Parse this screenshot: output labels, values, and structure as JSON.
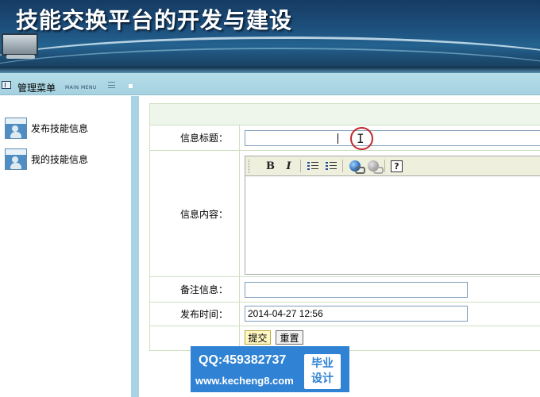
{
  "banner": {
    "title": "技能交换平台的开发与建设"
  },
  "menubar": {
    "title": "管理菜单",
    "subtitle": "MAIN MENU"
  },
  "sidebar": {
    "items": [
      {
        "label": "发布技能信息",
        "icon": "user-icon"
      },
      {
        "label": "我的技能信息",
        "icon": "user-icon"
      }
    ]
  },
  "form": {
    "fields": {
      "title_label": "信息标题：",
      "title_value": "",
      "content_label": "信息内容：",
      "note_label": "备注信息：",
      "note_value": "",
      "time_label": "发布时间：",
      "time_value": "2014-04-27 12:56"
    },
    "editor_toolbar": {
      "bold": "B",
      "italic": "I",
      "help": "?"
    },
    "buttons": {
      "submit": "提交",
      "reset": "重置"
    }
  },
  "watermark": {
    "qq": "QQ:459382737",
    "url": "www.kecheng8.com",
    "badge_line1": "毕业",
    "badge_line2": "设计"
  },
  "colors": {
    "banner": "#1d4f7c",
    "menubar": "#b7dde9",
    "divider": "#a9d3e2",
    "form_border": "#cfe0c0",
    "submit_bg": "#fff7c2",
    "watermark": "#2f82d4",
    "cursor_ring": "#c0282c"
  }
}
